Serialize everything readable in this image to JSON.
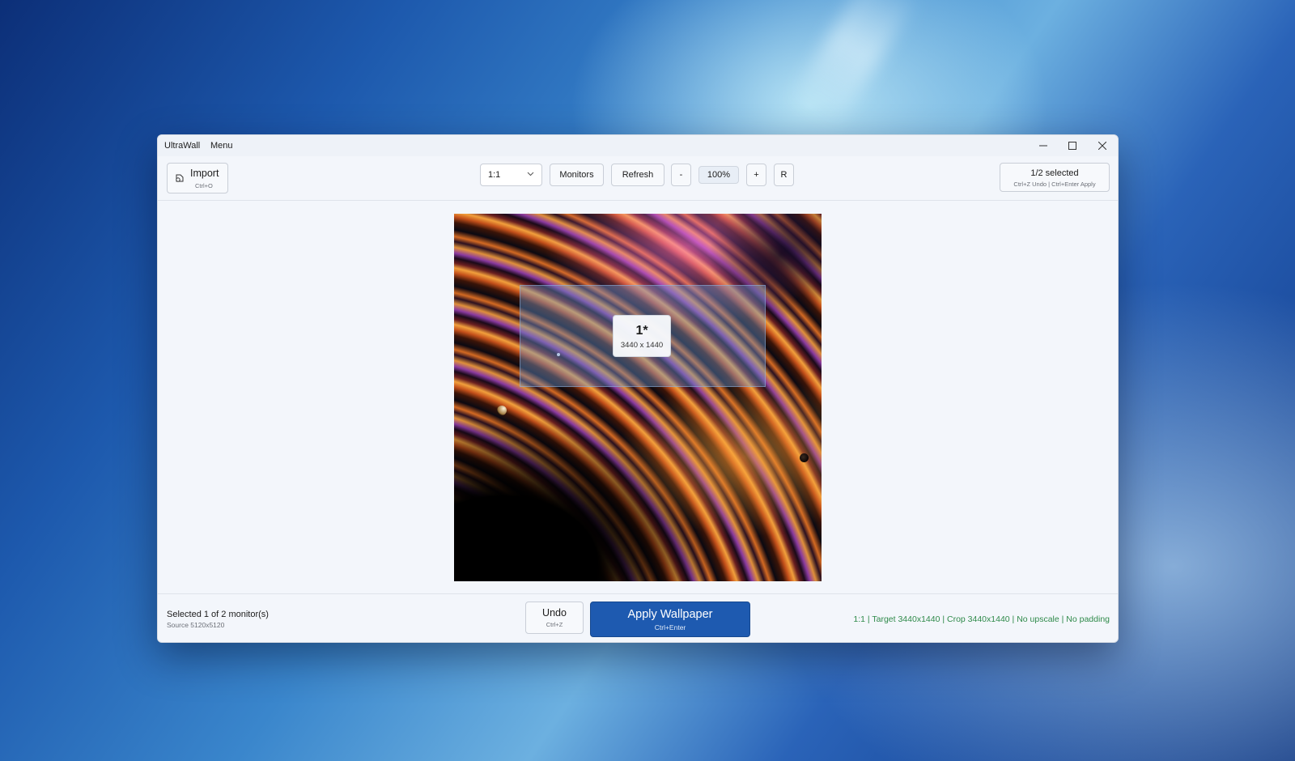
{
  "titlebar": {
    "app_name": "UltraWall",
    "menu_label": "Menu",
    "controls": [
      "minimize-icon",
      "maximize-icon",
      "close-icon"
    ]
  },
  "toolbar": {
    "import": {
      "label": "Import",
      "shortcut": "Ctrl+O",
      "icon": "import-icon"
    },
    "aspect_ratio": {
      "selected": "1:1",
      "icon": "chevron-down-icon"
    },
    "monitors_label": "Monitors",
    "refresh_label": "Refresh",
    "zoom_out_label": "-",
    "zoom_level": "100%",
    "zoom_in_label": "+",
    "reset_label": "R",
    "selection": {
      "title": "1/2 selected",
      "hints": "Ctrl+Z Undo  |  Ctrl+Enter Apply"
    }
  },
  "preview": {
    "monitor_label": "1*",
    "monitor_resolution": "3440 x 1440"
  },
  "footer": {
    "selected_text": "Selected 1 of 2 monitor(s)",
    "source_text": "Source 5120x5120",
    "undo": {
      "label": "Undo",
      "shortcut": "Ctrl+Z"
    },
    "apply": {
      "label": "Apply Wallpaper",
      "shortcut": "Ctrl+Enter"
    },
    "status_text": "1:1 | Target 3440x1440 | Crop 3440x1440 | No upscale | No padding"
  },
  "colors": {
    "accent": "#1e5ab0",
    "status_ok": "#2f8a4a"
  }
}
